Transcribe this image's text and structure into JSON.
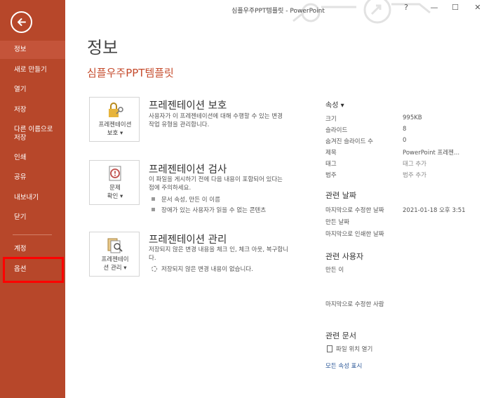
{
  "window": {
    "title": "심플우주PPT템플릿 - PowerPoint",
    "help": "?",
    "minimize": "—",
    "maximize": "☐",
    "close": "✕"
  },
  "sidebar": {
    "items": [
      {
        "label": "정보"
      },
      {
        "label": "새로 만들기"
      },
      {
        "label": "열기"
      },
      {
        "label": "저장"
      },
      {
        "label": "다른 이름으로 저장"
      },
      {
        "label": "인쇄"
      },
      {
        "label": "공유"
      },
      {
        "label": "내보내기"
      },
      {
        "label": "닫기"
      },
      {
        "label": "계정"
      },
      {
        "label": "옵션"
      }
    ],
    "accent": "#b7472a",
    "highlight_color": "#ff0000"
  },
  "main": {
    "title": "정보",
    "doc_name": "심플우주PPT템플릿",
    "protect": {
      "tile_line1": "프레젠테이션",
      "tile_line2": "보호 ▾",
      "heading": "프레젠테이션 보호",
      "desc": "사용자가 이 프레젠테이션에 대해 수행할 수 있는 변경 작업 유형을 관리합니다.",
      "icon": "lock-icon"
    },
    "inspect": {
      "tile_line1": "문제",
      "tile_line2": "확인 ▾",
      "heading": "프레젠테이션 검사",
      "desc": "이 파일을 게시하기 전에 다음 내용이 포함되어 있다는 점에 주의하세요.",
      "bullets": [
        "문서 속성, 만든 이 이름",
        "장애가 있는 사용자가 읽을 수 없는 콘텐츠"
      ],
      "icon": "inspect-icon"
    },
    "manage": {
      "tile_line1": "프레젠테이",
      "tile_line2": "션 관리 ▾",
      "heading": "프레젠테이션 관리",
      "desc": "저장되지 않은 변경 내용을 체크 인, 체크 아웃, 복구합니다.",
      "status": "저장되지 않은 변경 내용이 없습니다.",
      "icon": "manage-icon"
    }
  },
  "properties": {
    "header": "속성 ▾",
    "rows": [
      {
        "label": "크기",
        "value": "995KB",
        "muted": false
      },
      {
        "label": "슬라이드",
        "value": "8",
        "muted": false
      },
      {
        "label": "숨겨진 슬라이드 수",
        "value": "0",
        "muted": false
      },
      {
        "label": "제목",
        "value": "PowerPoint 프레젠...",
        "muted": false
      },
      {
        "label": "태그",
        "value": "태그 추가",
        "muted": true
      },
      {
        "label": "범주",
        "value": "범주 추가",
        "muted": true
      }
    ],
    "dates_title": "관련 날짜",
    "dates": [
      {
        "label": "마지막으로 수정한 날짜",
        "value": "2021-01-18 오후 3:51"
      },
      {
        "label": "만든 날짜",
        "value": ""
      },
      {
        "label": "마지막으로 인쇄한 날짜",
        "value": ""
      }
    ],
    "people_title": "관련 사용자",
    "author_label": "만든 이",
    "last_modified_by_label": "마지막으로 수정한 사람",
    "docs_title": "관련 문서",
    "open_file_location": "파일 위치 열기",
    "show_all": "모든 속성 표시"
  }
}
